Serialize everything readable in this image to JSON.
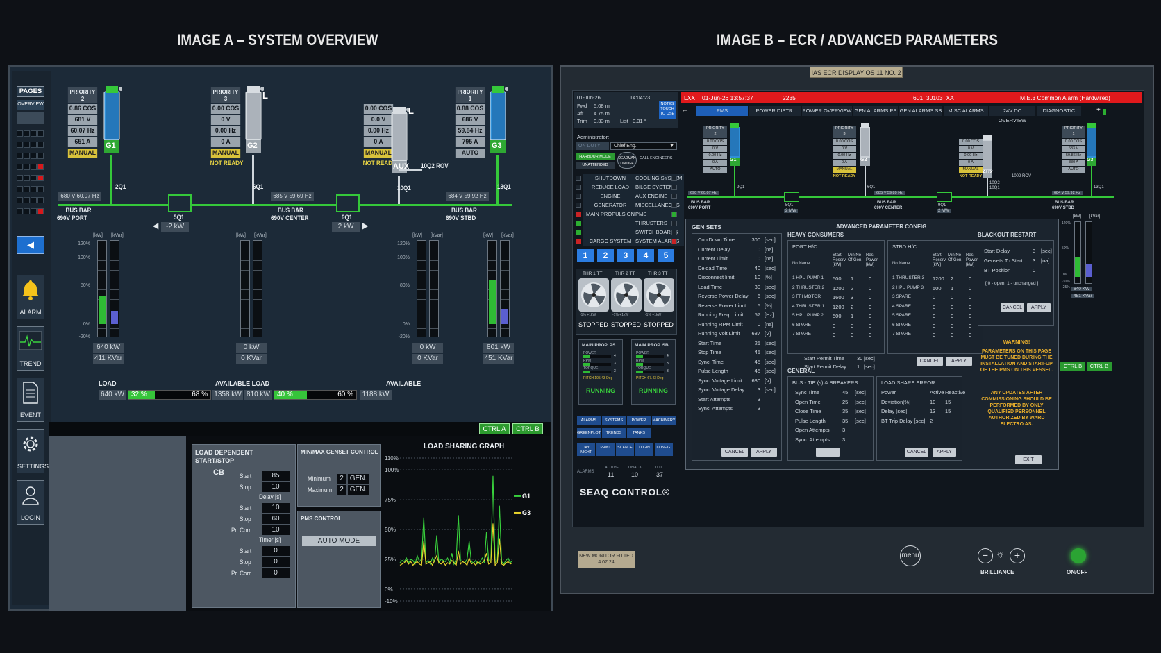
{
  "titles": {
    "a": "IMAGE A – SYSTEM OVERVIEW",
    "b": "IMAGE B – ECR / ADVANCED PARAMETERS"
  },
  "colors": {
    "accent_green": "#35c83a",
    "alarm_red": "#e0191c",
    "blue_btn": "#2b7ce0",
    "manual_yellow": "#d8c23b"
  },
  "panelA": {
    "sidebar": {
      "pages": "PAGES",
      "overview": "OVERVIEW",
      "alarm": "ALARM",
      "trend": "TREND",
      "event": "EVENT",
      "settings": "SETTINGS",
      "login": "LOGIN"
    },
    "gens": [
      {
        "id": "G1",
        "priority_label": "PRIORITY",
        "priority": "2",
        "cos": "0.86 COS",
        "v": "681 V",
        "hz": "60.07 Hz",
        "a": "651 A",
        "mode": "MANUAL",
        "status": ""
      },
      {
        "id": "G2",
        "priority_label": "PRIORITY",
        "priority": "3",
        "cos": "0.00 COS",
        "v": "0 V",
        "hz": "0.00 Hz",
        "a": "0 A",
        "mode": "MANUAL",
        "status": "NOT READY"
      },
      {
        "id": "AUX",
        "priority_label": "",
        "priority": "",
        "cos": "0.00 COS",
        "v": "0.0 V",
        "hz": "0.00 Hz",
        "a": "0 A",
        "mode": "MANUAL",
        "status": "NOT READY"
      },
      {
        "id": "G3",
        "priority_label": "PRIORITY",
        "priority": "1",
        "cos": "0.88 COS",
        "v": "686 V",
        "hz": "59.84 Hz",
        "a": "795 A",
        "mode": "AUTO",
        "status": ""
      }
    ],
    "breakers": {
      "q2q1": "2Q1",
      "q6q1": "6Q1",
      "q10q1": "10Q1",
      "q10q2": "10Q2 ROV",
      "q13q1": "13Q1",
      "q5q1": "5Q1",
      "q9q1": "9Q1"
    },
    "bus": {
      "port_readout": "680 V  60.07 Hz",
      "center_readout": "685 V  59.69 Hz",
      "stbd_readout": "684 V  59.92 Hz",
      "port_label": "BUS BAR",
      "port_sub": "690V PORT",
      "center_label": "BUS BAR",
      "center_sub": "690V CENTER",
      "stbd_label": "BUS BAR",
      "stbd_sub": "690V STBD",
      "tie1_kw": "-2 kW",
      "tie2_kw": "2 kW"
    },
    "gauges": [
      {
        "kw_label": "[kW]",
        "kvar_label": "[kVar]",
        "kw": "640 kW",
        "kvar": "411 KVar",
        "kw_level": 0.283,
        "kvar_level": 0.133
      },
      {
        "kw_label": "[kW]",
        "kvar_label": "[kVar]",
        "kw": "0 kW",
        "kvar": "0 KVar",
        "kw_level": 0,
        "kvar_level": 0
      },
      {
        "kw_label": "[kW]",
        "kvar_label": "[kVar]",
        "kw": "0 kW",
        "kvar": "0 KVar",
        "kw_level": 0,
        "kvar_level": 0
      },
      {
        "kw_label": "[kW]",
        "kvar_label": "[kVar]",
        "kw": "801 kW",
        "kvar": "451 KVar",
        "kw_level": 0.45,
        "kvar_level": 0.15
      }
    ],
    "gauge_scale": [
      "120%",
      "100%",
      "80%",
      "0%",
      "-20%"
    ],
    "load": {
      "load_label": "LOAD",
      "avail_label": "AVAILABLE LOAD",
      "avail2_label": "AVAILABLE",
      "l1_kw": "640 kW",
      "l1_pct": "32 %",
      "l1_pct2": "68 %",
      "l1_avail": "1358 kW",
      "l2_kw": "810 kW",
      "l2_pct": "40 %",
      "l2_pct2": "60 %",
      "l2_avail": "1188 kW",
      "l1_level": 0.32,
      "l2_level": 0.4
    },
    "ctrl_a": "CTRL A",
    "ctrl_b": "CTRL B",
    "lds": {
      "title": "LOAD DEPENDENT",
      "title2": "START/STOP",
      "cb": "CB",
      "start": "Start",
      "stop": "Stop",
      "delay": "Delay [s]",
      "prcorr": "Pr. Corr",
      "timer": "Timer [s]",
      "v_start": "85",
      "v_stop": "10",
      "d_start": "10",
      "d_stop": "60",
      "d_pr": "10",
      "t_start": "0",
      "t_stop": "0",
      "t_pr": "0"
    },
    "minmax": {
      "title": "MIN/MAX GENSET CONTROL",
      "min": "Minimum",
      "max": "Maximum",
      "min_v": "2",
      "max_v": "2",
      "gen": "GEN."
    },
    "pms": {
      "title": "PMS CONTROL",
      "mode": "AUTO MODE"
    },
    "graph": {
      "title": "LOAD SHARING GRAPH",
      "ticks": [
        "110%",
        "100%",
        "75%",
        "50%",
        "25%",
        "0%",
        "-10%"
      ],
      "g1": "G1",
      "g3": "G3",
      "g1_series": [
        22,
        24,
        23,
        26,
        22,
        25,
        24,
        21,
        28,
        23,
        25,
        60,
        22,
        24,
        21,
        26,
        23,
        45,
        22,
        25,
        24,
        23,
        26,
        22,
        30,
        21,
        25,
        62,
        24,
        23,
        22,
        25,
        40,
        23,
        22,
        24,
        21,
        23,
        26,
        22,
        48,
        24,
        23,
        95,
        22,
        24,
        70,
        23,
        21,
        24,
        26,
        22,
        24
      ],
      "g3_series": [
        20,
        21,
        22,
        24,
        21,
        23,
        20,
        22,
        23,
        21,
        20,
        40,
        21,
        22,
        23,
        20,
        24,
        28,
        22,
        21,
        23,
        20,
        22,
        21,
        24,
        22,
        20,
        32,
        21,
        23,
        22,
        20,
        26,
        21,
        22,
        20,
        23,
        21,
        22,
        24,
        30,
        21,
        22,
        55,
        20,
        22,
        42,
        21,
        20,
        22,
        23,
        21,
        22
      ]
    }
  },
  "panelB": {
    "badge": "IAS ECR DISPLAY OS 11 NO. 2",
    "hdr": {
      "date": "01-Jun-26",
      "time": "14:04:23",
      "fwd": "Fwd",
      "fwd_v": "5.08 m",
      "aft": "Aft",
      "aft_v": "4.75 m",
      "trim": "Trim",
      "trim_v": "0.33 m",
      "list": "List",
      "list_v": "0.31 °",
      "notes": "NOTES TOUCH TO USE"
    },
    "alarm_bar": {
      "code": "LXX",
      "datetime": "01-Jun-26  13:57:37",
      "num": "2235",
      "tag": "601_30103_XA",
      "text": "M.E.3 Common Alarm (Hardwired)"
    },
    "tabs": [
      "PMS",
      "POWER DISTR.",
      "POWER OVERVIEW",
      "GEN ALARMS PS",
      "GEN ALARMS SB",
      "MISC ALARMS",
      "24V DC OVERVIEW",
      "DIAGNOSTIC"
    ],
    "admin": "Administrator:",
    "on_duty": "ON DUTY",
    "chief": "Chief Eng.",
    "harbour": "HARBOUR MODE",
    "unattended": "UNATTENDED",
    "deadman": "DEADMAN ON OFF",
    "call_eng": "CALL ENGINEERS",
    "sys_buttons": [
      [
        "SHUTDOWN",
        "COOLING SYSTEM"
      ],
      [
        "REDUCE LOAD",
        "BILGE SYSTEMS"
      ],
      [
        "ENGINE",
        "AUX ENGINE"
      ],
      [
        "GENERATOR",
        "MISCELLANEOUS"
      ],
      [
        "MAIN PROPULSION",
        "PMS"
      ],
      [
        "",
        "THRUSTERS"
      ],
      [
        "",
        "SWITCHBOARDS"
      ],
      [
        "CARGO SYSTEM",
        "SYSTEM ALARMS"
      ]
    ],
    "pages": [
      "1",
      "2",
      "3",
      "4",
      "5"
    ],
    "thr": [
      {
        "name": "THR 1 TT",
        "st": "STOPPED"
      },
      {
        "name": "THR 2 TT",
        "st": "STOPPED"
      },
      {
        "name": "THR 3 TT",
        "st": "STOPPED"
      }
    ],
    "thr_scale": "-1%  +1kW",
    "mp": [
      {
        "name": "MAIN PROP. PS",
        "st": "RUNNING",
        "pitch": "PITCH  105.43 Deg"
      },
      {
        "name": "MAIN PROP. SB",
        "st": "RUNNING",
        "pitch": "PITCH  67.43 Deg"
      }
    ],
    "mp_rows": [
      "POWER",
      "RPM",
      "TORQUE"
    ],
    "mp_vals": [
      "4",
      "3",
      "3"
    ],
    "nav1": [
      "ALARMS",
      "SYSTEMS",
      "POWER",
      "MACHINERY"
    ],
    "nav2": [
      "GREENPLOT",
      "TRENDS",
      "TANKS"
    ],
    "nav3": [
      "DAY NIGHT",
      "PRINT",
      "SILENCE",
      "LOGIN",
      "CONFIG."
    ],
    "alm_label": "ALARMS",
    "alm_active": "ACTIVE",
    "alm_unack": "UNACK",
    "alm_tot": "TOT",
    "alm_v1": "11",
    "alm_v2": "10",
    "alm_v3": "37",
    "logo": "SEAQ CONTROL®",
    "mini": {
      "gens": [
        {
          "id": "G1",
          "pr": "PRIORITY",
          "p": "2",
          "r": [
            "0.00 COS",
            "0 V",
            "0.00 Hz",
            "0 A",
            "AUTO"
          ]
        },
        {
          "id": "G2",
          "pr": "PRIORITY",
          "p": "3",
          "r": [
            "0.00 COS",
            "0 V",
            "0.00 Hz",
            "0 A",
            "MANUAL",
            "NOT READY"
          ]
        },
        {
          "id": "AUX",
          "pr": "",
          "p": "",
          "r": [
            "0.00 COS",
            "0 V",
            "0.00 Hz",
            "0 A",
            "MANUAL",
            "NOT READY"
          ]
        },
        {
          "id": "G3",
          "pr": "PRIORITY",
          "p": "1",
          "r": [
            "0.00 COS",
            "683 V",
            "59.86 Hz",
            "880 A",
            "AUTO"
          ]
        }
      ],
      "b2q1": "2Q1",
      "b6q1": "6Q1",
      "b10q1": "10Q2\n10Q1",
      "b13q1": "13Q1",
      "rov": "1002 ROV",
      "busp": "690 V  60.07 Hz",
      "busc": "685 V  59.89 Hz",
      "buss": "684 V  59.92 Hz",
      "bb1": "BUS BAR",
      "bb1s": "690V PORT",
      "bb2": "BUS BAR",
      "bb2s": "690V CENTER",
      "bb3": "BUS BAR",
      "bb3s": "690V STBD",
      "t1": "5Q1",
      "t1k": "2 MW",
      "t2": "9Q1",
      "t2k": "2 MW",
      "kw": "[kW]",
      "kvar": "[kVar]",
      "kw_v": "640 KW",
      "kvar_v": "451 KVar",
      "sc": [
        "120%",
        "50%",
        "0%",
        "-30%",
        "-25%"
      ]
    },
    "gensets": {
      "title": "GEN SETS",
      "rows": [
        [
          "CoolDown Time",
          "300",
          "[sec]"
        ],
        [
          "Current Delay",
          "0",
          "[na]"
        ],
        [
          "Current Limit",
          "0",
          "[na]"
        ],
        [
          "Deload Time",
          "40",
          "[sec]"
        ],
        [
          "Disconnect limit",
          "10",
          "[%]"
        ],
        [
          "Load Time",
          "30",
          "[sec]"
        ],
        [
          "Reverse Power Delay",
          "6",
          "[sec]"
        ],
        [
          "Reverse Power Limit",
          "5",
          "[%]"
        ],
        [
          "Running Freq. Limit",
          "57",
          "[Hz]"
        ],
        [
          "Running RPM Limit",
          "0",
          "[na]"
        ],
        [
          "Running Volt Limit",
          "687",
          "[V]"
        ],
        [
          "Start Time",
          "25",
          "[sec]"
        ],
        [
          "Stop Time",
          "45",
          "[sec]"
        ],
        [
          "Sync. Time",
          "45",
          "[sec]"
        ],
        [
          "Pulse Length",
          "45",
          "[sec]"
        ],
        [
          "Sync. Voltage Limit",
          "680",
          "[V]"
        ],
        [
          "Sync. Voltage Delay",
          "3",
          "[sec]"
        ],
        [
          "Start Attempts",
          "3",
          ""
        ],
        [
          "Sync. Attempts",
          "3",
          ""
        ]
      ],
      "cancel": "CANCEL",
      "apply": "APPLY"
    },
    "adv_title": "ADVANCED PARAMETER CONFIG",
    "heavy": {
      "title": "HEAVY CONSUMERS",
      "port": "PORT H/C",
      "stbd": "STBD H/C",
      "hdr": [
        "No Name",
        "Start Reserv [kW]",
        "Min No Of Gen.",
        "Res. Power [kW]"
      ],
      "port_rows": [
        [
          "1 HPU PUMP 1",
          "500",
          "1",
          "0"
        ],
        [
          "2 THRUSTER 2",
          "1200",
          "2",
          "0"
        ],
        [
          "3 FFI MOTOR",
          "1600",
          "3",
          "0"
        ],
        [
          "4 THRUSTER 1",
          "1200",
          "2",
          "0"
        ],
        [
          "5 HPU PUMP 2",
          "500",
          "1",
          "0"
        ],
        [
          "6 SPARE",
          "0",
          "0",
          "0"
        ],
        [
          "7 SPARE",
          "0",
          "0",
          "0"
        ]
      ],
      "stbd_rows": [
        [
          "1 THRUSTER 3",
          "1200",
          "2",
          "0"
        ],
        [
          "2 HPU PUMP 3",
          "500",
          "1",
          "0"
        ],
        [
          "3 SPARE",
          "0",
          "0",
          "0"
        ],
        [
          "4 SPARE",
          "0",
          "0",
          "0"
        ],
        [
          "5 SPARE",
          "0",
          "0",
          "0"
        ],
        [
          "6 SPARE",
          "0",
          "0",
          "0"
        ],
        [
          "7 SPARE",
          "0",
          "0",
          "0"
        ]
      ],
      "spt": "Start Permit Time",
      "spt_v": "30",
      "spt_u": "[sec]",
      "spd": "Start Permit Delay",
      "spd_v": "1",
      "spd_u": "[sec]",
      "cancel": "CANCEL",
      "apply": "APPLY"
    },
    "blackout": {
      "title": "BLACKOUT RESTART",
      "rows": [
        [
          "Start Delay",
          "3",
          "[sec]"
        ],
        [
          "Gensets To Start",
          "3",
          "[na]"
        ],
        [
          "BT Position",
          "0",
          ""
        ]
      ],
      "hint": "[ 0 - open, 1 - unchanged ]",
      "cancel": "CANCEL",
      "apply": "APPLY"
    },
    "general": {
      "title": "GENERAL",
      "bus_title": "BUS - TIE (s) & BREAKERS",
      "bus_rows": [
        [
          "Sync Time",
          "45",
          "[sec]"
        ],
        [
          "Open Time",
          "25",
          "[sec]"
        ],
        [
          "Close Time",
          "35",
          "[sec]"
        ],
        [
          "Pulse Length",
          "35",
          "[sec]"
        ],
        [
          "Open Attempts",
          "3",
          ""
        ],
        [
          "Sync. Attempts",
          "3",
          ""
        ]
      ],
      "lse_title": "LOAD SHARE ERROR",
      "lse_hdr": [
        "Active",
        "Reactive"
      ],
      "lse_rows": [
        [
          "Power",
          "Active",
          "Reactive"
        ],
        [
          "Deviation[%]",
          "10",
          "15"
        ],
        [
          "Delay [sec]",
          "13",
          "15"
        ],
        [
          "BT Trip Delay [sec]",
          "2",
          ""
        ]
      ],
      "cancel": "CANCEL",
      "apply": "APPLY"
    },
    "warning": {
      "title": "WARNING!",
      "l1": "PARAMETERS ON THIS PAGE MUST BE TUNED DURING THE INSTALLATION AND START-UP OF THE PMS ON THIS VESSEL.",
      "l2": "ANY UPDATES AFTER COMMISSIONING SHOULD BE PERFORMED BY ONLY QUALIFIED PERSONNEL AUTHORIZED BY WARD ELECTRO AS."
    },
    "exit": "EXIT",
    "ctrl_b1": "CTRL B",
    "ctrl_b2": "CTRL B",
    "sticker": "NEW MONITOR FITTED 4.07.24",
    "menu": "menu",
    "brilliance": "BRILLIANCE",
    "onoff": "ON/OFF"
  }
}
